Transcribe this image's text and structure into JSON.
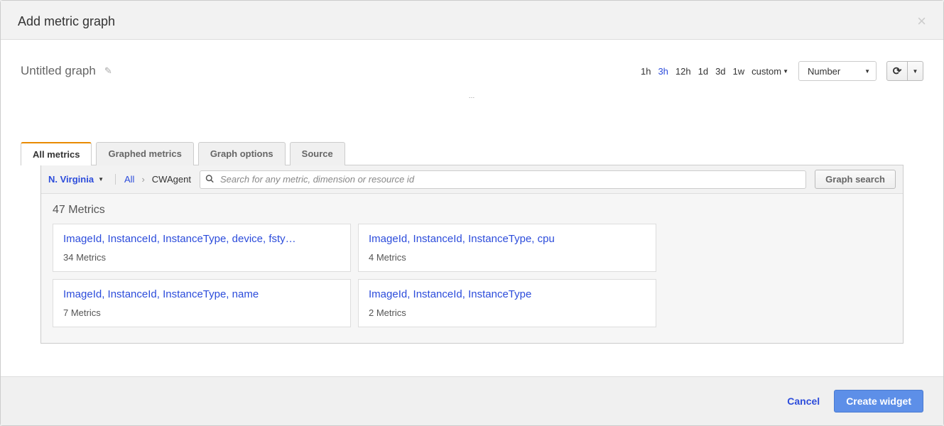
{
  "modal": {
    "title": "Add metric graph"
  },
  "graph": {
    "title": "Untitled graph",
    "number_label": "Number"
  },
  "time_ranges": [
    "1h",
    "3h",
    "12h",
    "1d",
    "3d",
    "1w"
  ],
  "time_active_index": 1,
  "custom_label": "custom",
  "tabs": [
    "All metrics",
    "Graphed metrics",
    "Graph options",
    "Source"
  ],
  "tab_active_index": 0,
  "region": "N. Virginia",
  "breadcrumb": {
    "root": "All",
    "current": "CWAgent"
  },
  "search": {
    "placeholder": "Search for any metric, dimension or resource id"
  },
  "graph_search_label": "Graph search",
  "metrics_count_label": "47 Metrics",
  "cards": [
    {
      "title": "ImageId, InstanceId, InstanceType, device, fsty…",
      "sub": "34 Metrics"
    },
    {
      "title": "ImageId, InstanceId, InstanceType, cpu",
      "sub": "4 Metrics"
    },
    {
      "title": "ImageId, InstanceId, InstanceType, name",
      "sub": "7 Metrics"
    },
    {
      "title": "ImageId, InstanceId, InstanceType",
      "sub": "2 Metrics"
    }
  ],
  "footer": {
    "cancel": "Cancel",
    "create": "Create widget"
  }
}
